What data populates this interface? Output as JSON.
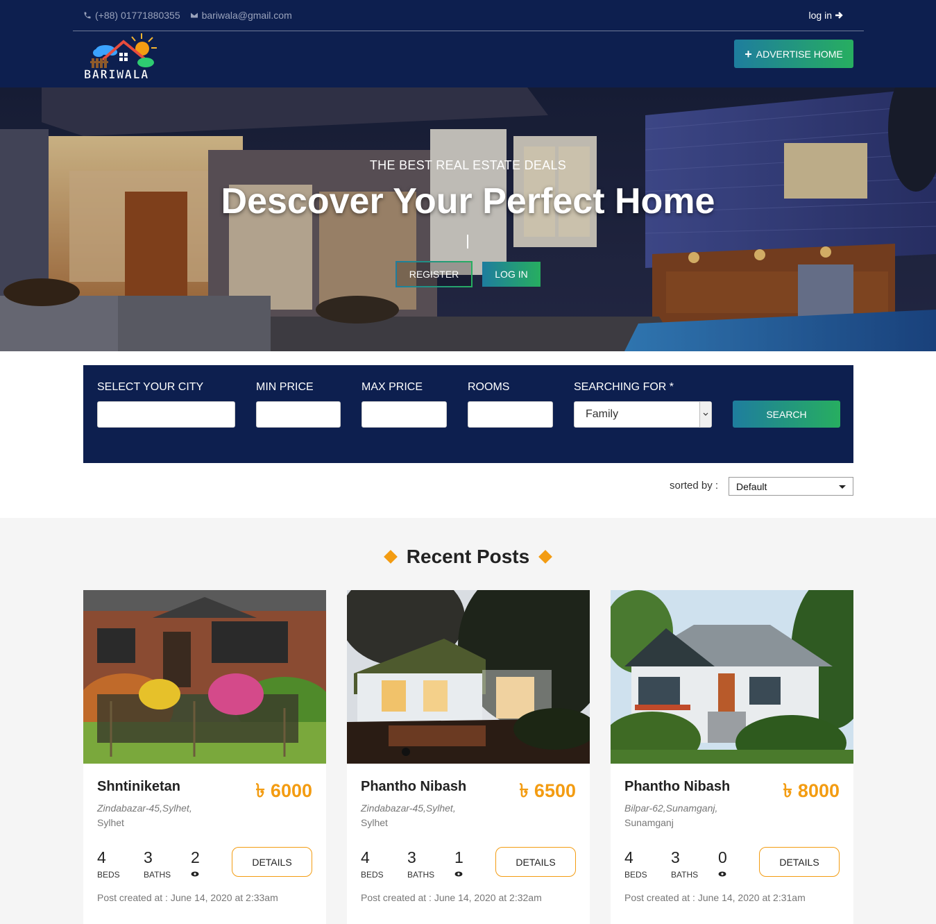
{
  "header": {
    "phone": "(+88) 01771880355",
    "email": "bariwala@gmail.com",
    "login_label": "log in",
    "logo_text": "BARIWALA",
    "advertise_label": "ADVERTISE HOME"
  },
  "hero": {
    "subtitle": "THE BEST REAL ESTATE DEALS",
    "title": "Descover Your Perfect Home",
    "register_label": "REGISTER",
    "login_label": "LOG IN"
  },
  "search": {
    "city_label": "SELECT YOUR CITY",
    "min_price_label": "MIN PRICE",
    "max_price_label": "MAX PRICE",
    "rooms_label": "ROOMS",
    "searching_for_label": "SEARCHING FOR *",
    "searching_for_value": "Family",
    "search_label": "SEARCH"
  },
  "sort": {
    "label": "sorted by :",
    "value": "Default"
  },
  "posts": {
    "section_title": "Recent Posts",
    "currency": "৳",
    "details_label": "DETAILS",
    "beds_label": "BEDS",
    "baths_label": "BATHS",
    "items": [
      {
        "title": "Shntiniketan",
        "price": "6000",
        "address_italic": "Zindabazar-45,Sylhet,",
        "address_plain": " Sylhet",
        "beds": "4",
        "baths": "3",
        "views": "2",
        "date": "Post created at : June 14, 2020 at 2:33am"
      },
      {
        "title": "Phantho Nibash",
        "price": "6500",
        "address_italic": "Zindabazar-45,Sylhet,",
        "address_plain": " Sylhet",
        "beds": "4",
        "baths": "3",
        "views": "1",
        "date": "Post created at : June 14, 2020 at 2:32am"
      },
      {
        "title": "Phantho Nibash",
        "price": "8000",
        "address_italic": "Bilpar-62,Sunamganj,",
        "address_plain": " Sunamganj",
        "beds": "4",
        "baths": "3",
        "views": "0",
        "date": "Post created at : June 14, 2020 at 2:31am"
      }
    ]
  }
}
